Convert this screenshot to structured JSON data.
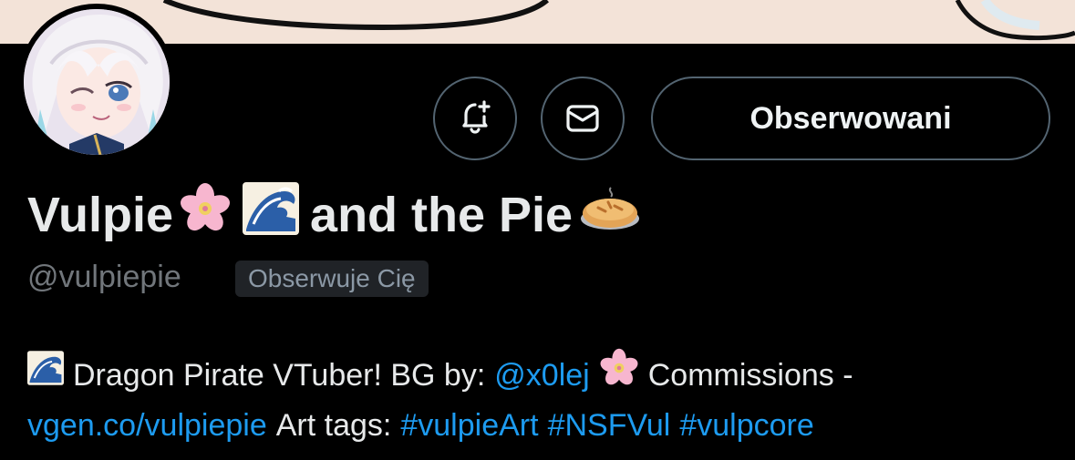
{
  "profile": {
    "display_name_part1": "Vulpie",
    "display_name_part2": "and the Pie",
    "handle": "@vulpiepie",
    "follows_you_badge": "Obserwuje Cię"
  },
  "actions": {
    "follow_label": "Obserwowani",
    "notifications_icon": "bell-plus-icon",
    "message_icon": "mail-icon"
  },
  "bio": {
    "text1": "Dragon Pirate VTuber! BG by:",
    "mention": "@x0lej",
    "text2": "Commissions -",
    "link": "vgen.co/vulpiepie",
    "text3": "Art tags:",
    "tags": [
      "#vulpieArt",
      "#NSFVul",
      "#vulpcore"
    ]
  },
  "colors": {
    "background": "#000000",
    "link": "#1d9bf0",
    "muted": "#71767b",
    "border": "#536471",
    "banner": "#f3e3d8"
  }
}
